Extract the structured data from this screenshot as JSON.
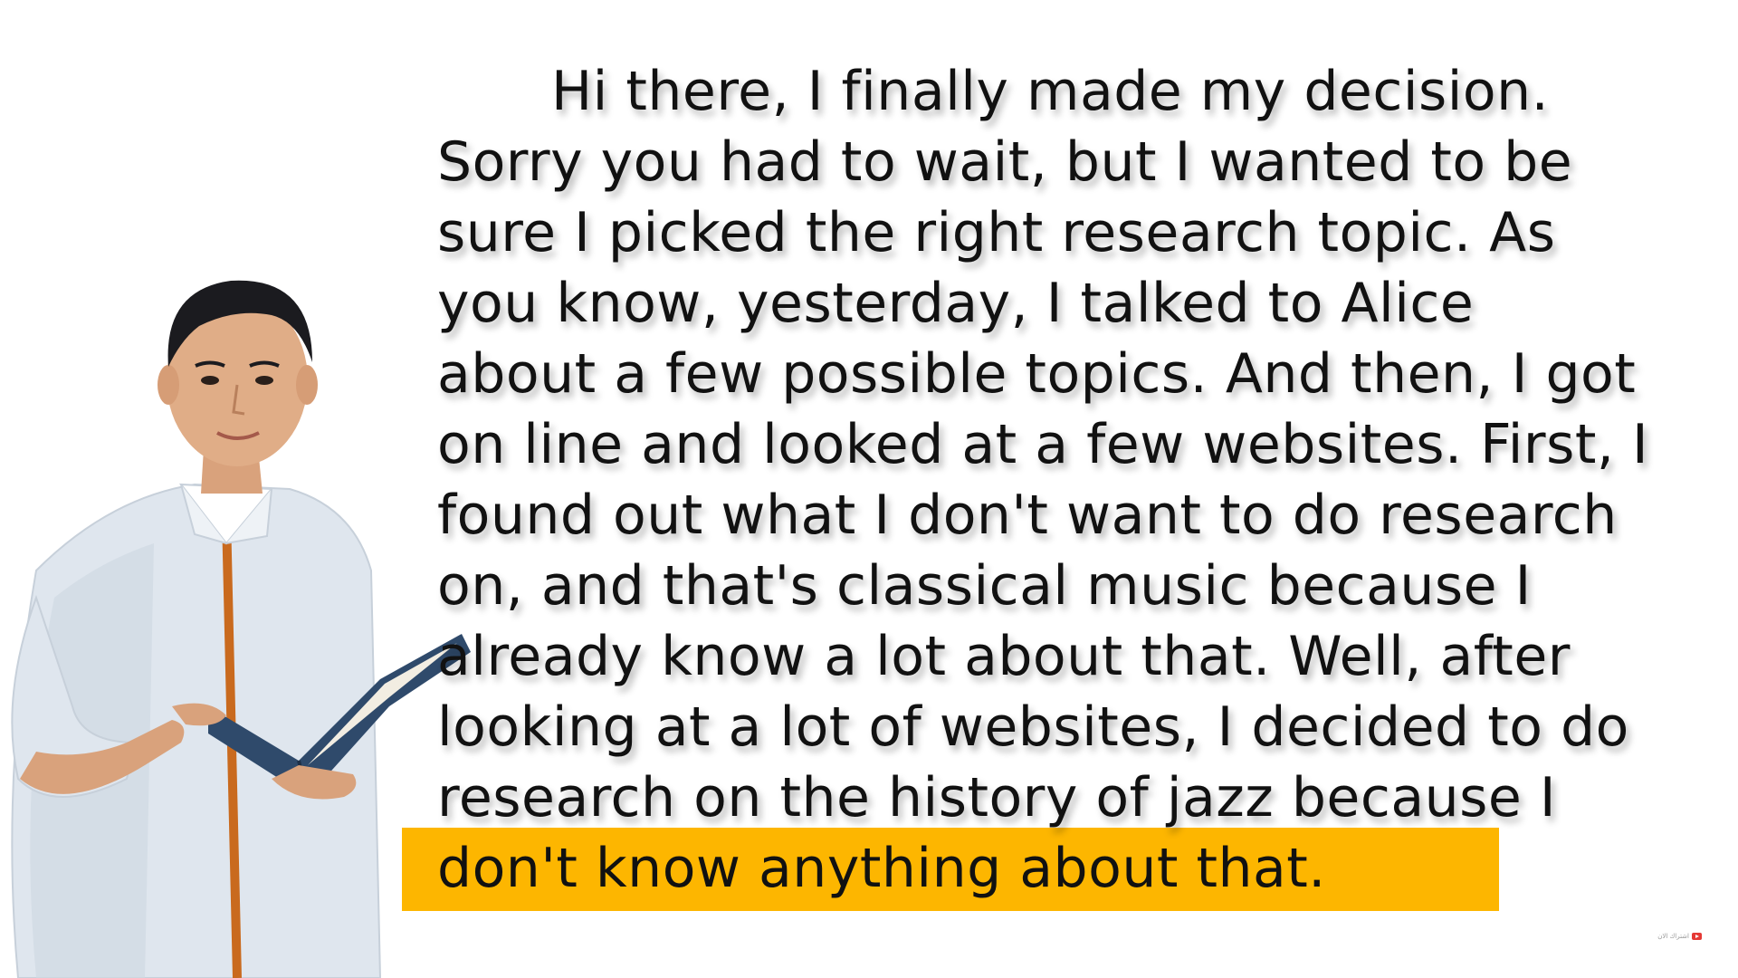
{
  "reading": {
    "lines": [
      "Hi there, I finally made my decision.",
      "Sorry you had to wait, but I wanted to be",
      "sure I picked the right research topic. As",
      "you know, yesterday, I talked to Alice",
      "about a few possible topics. And then, I got",
      "on line and looked at a few websites. First, I",
      "found out what I don't want to do research",
      "on, and that's classical music because I",
      "already know a lot about that. Well, after",
      "looking at a lot of websites, I decided to do",
      "research on the history of jazz because I",
      "don't know anything about that."
    ],
    "highlighted_line_index": 11
  },
  "colors": {
    "highlight": "#fdb600",
    "text": "#111111",
    "background": "#ffffff"
  },
  "figure": {
    "icon": "person-holding-book-icon"
  },
  "watermark": {
    "label": "اشتراك الان",
    "icon": "youtube-play-icon"
  }
}
